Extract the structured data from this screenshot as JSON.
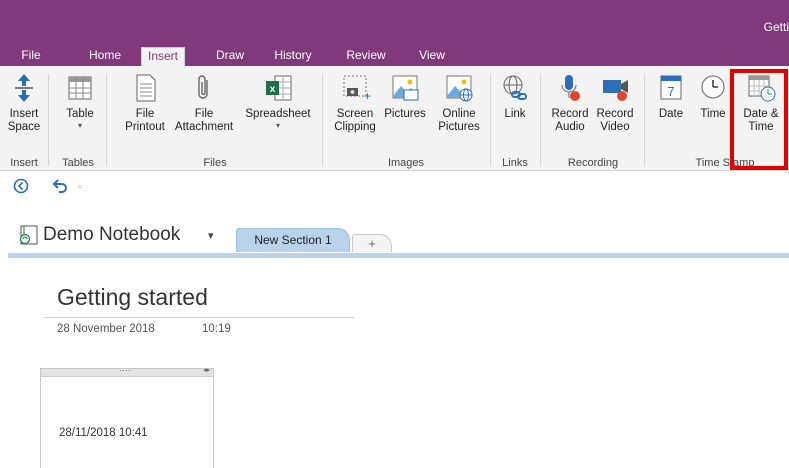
{
  "app_title": "Getti",
  "tabs": [
    {
      "label": "File"
    },
    {
      "label": "Home"
    },
    {
      "label": "Insert"
    },
    {
      "label": "Draw"
    },
    {
      "label": "History"
    },
    {
      "label": "Review"
    },
    {
      "label": "View"
    }
  ],
  "active_tab": "Insert",
  "ribbon": {
    "buttons": [
      {
        "label": "Insert\nSpace",
        "icon": "insert-space-icon"
      },
      {
        "label": "Table",
        "icon": "table-icon"
      },
      {
        "label": "File\nPrintout",
        "icon": "file-printout-icon"
      },
      {
        "label": "File\nAttachment",
        "icon": "paperclip-icon"
      },
      {
        "label": "Spreadsheet",
        "icon": "spreadsheet-icon"
      },
      {
        "label": "Screen\nClipping",
        "icon": "screen-clipping-icon"
      },
      {
        "label": "Pictures",
        "icon": "pictures-icon"
      },
      {
        "label": "Online\nPictures",
        "icon": "online-pictures-icon"
      },
      {
        "label": "Link",
        "icon": "link-icon"
      },
      {
        "label": "Record\nAudio",
        "icon": "record-audio-icon"
      },
      {
        "label": "Record\nVideo",
        "icon": "record-video-icon"
      },
      {
        "label": "Date",
        "icon": "date-icon"
      },
      {
        "label": "Time",
        "icon": "clock-icon"
      },
      {
        "label": "Date &\nTime",
        "icon": "date-time-icon"
      }
    ],
    "groups": [
      {
        "label": "Insert"
      },
      {
        "label": "Tables"
      },
      {
        "label": "Files"
      },
      {
        "label": "Images"
      },
      {
        "label": "Links"
      },
      {
        "label": "Recording"
      },
      {
        "label": "Time Stamp"
      }
    ],
    "dropdown_glyph": "▾"
  },
  "qat": {
    "back_icon": "back-circle-icon",
    "undo_icon": "undo-icon",
    "customize_glyph": "="
  },
  "notebook": {
    "name": "Demo Notebook",
    "caret": "▾",
    "section_tab": "New Section 1",
    "add_tab": "+"
  },
  "page": {
    "title": "Getting started",
    "date": "28 November 2018",
    "time": "10:19",
    "note_grip": "····",
    "note_arrows": "◂▸",
    "note_text": "28/11/2018 10:41"
  }
}
